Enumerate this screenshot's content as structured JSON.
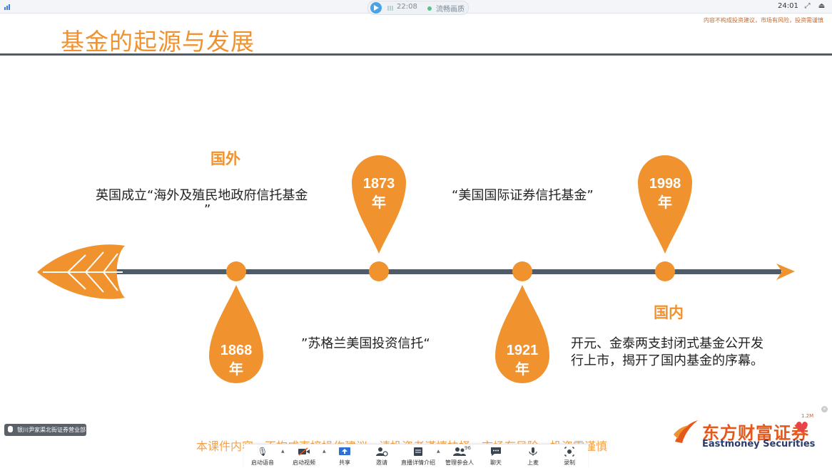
{
  "window": {
    "time": "22:08",
    "quality": "流畅画质",
    "clock": "24:01"
  },
  "slide": {
    "title": "基金的起源与发展",
    "disclaimer_top": "内容不构成投资建议，市场有风险，投资需谨慎",
    "region_foreign": "国外",
    "region_domestic": "国内",
    "events": [
      {
        "year": "1868",
        "unit": "年"
      },
      {
        "year": "1873",
        "unit": "年"
      },
      {
        "year": "1921",
        "unit": "年"
      },
      {
        "year": "1998",
        "unit": "年"
      }
    ],
    "text_1868_line1": "英国成立“海外及殖民地政府信托基金",
    "text_1868_line2": "”",
    "text_1873": "”苏格兰美国投资信托“",
    "text_1921": "“美国国际证券信托基金”",
    "text_1998_line1": "开元、金泰两支封闭式基金公开发",
    "text_1998_line2": "行上市，揭开了国内基金的序幕。",
    "bottom_disclaimer": "本课件内容，不构成直接操作建议，请投资者谨慎抉择，市场有风险，投资需谨慎",
    "brand_name": "东方财富证券",
    "brand_en": "Eastmoney Securities",
    "brand_version": "1.2M"
  },
  "presenter": {
    "label": "银川尹家渠北街证券营业部"
  },
  "toolbar": {
    "items": [
      {
        "label": "启动语音",
        "icon": "microphone-icon"
      },
      {
        "label": "启动视频",
        "icon": "video-camera-icon"
      },
      {
        "label": "共享",
        "icon": "share-screen-icon"
      },
      {
        "label": "邀请",
        "icon": "invite-icon"
      },
      {
        "label": "直播详情介绍",
        "icon": "document-icon"
      },
      {
        "label": "管理参会人",
        "icon": "participants-icon"
      },
      {
        "label": "聊天",
        "icon": "chat-icon"
      },
      {
        "label": "上麦",
        "icon": "mic-up-icon"
      },
      {
        "label": "录制",
        "icon": "record-icon"
      }
    ],
    "participant_count": "96"
  },
  "colors": {
    "accent": "#f0922e",
    "timeline": "#4f5b66",
    "brand": "#e4581c"
  }
}
